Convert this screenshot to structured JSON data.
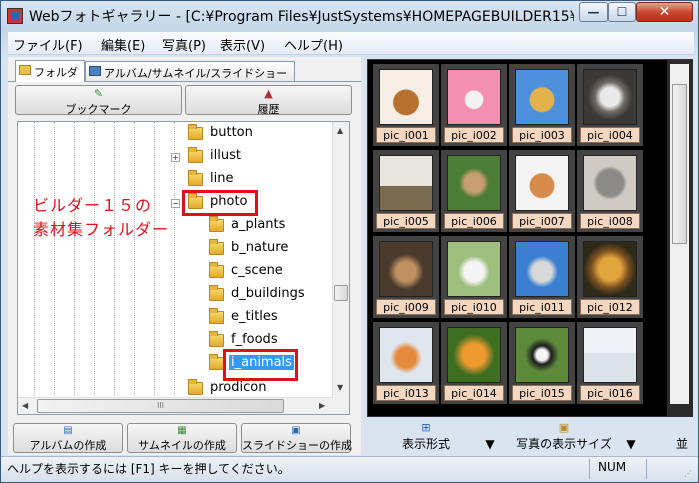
{
  "window": {
    "title": "Webフォトギャラリー - [C:¥Program Files¥JustSystems¥HOMEPAGEBUILDER15¥...",
    "minimize_glyph": "—",
    "maximize_glyph": "☐",
    "close_glyph": "✕",
    "colors": {
      "titlebar": "#c3d6e9",
      "close": "#c7432b",
      "selection": "#3399ff",
      "annotation": "#e0101a",
      "label_bg": "#f3d7c0"
    }
  },
  "menubar": {
    "items": [
      {
        "label": "ファイル(F)"
      },
      {
        "label": "編集(E)"
      },
      {
        "label": "写真(P)"
      },
      {
        "label": "表示(V)"
      },
      {
        "label": "ヘルプ(H)"
      }
    ]
  },
  "left_panel": {
    "tabs": [
      {
        "label": "フォルダ",
        "icon": "folder-icon"
      },
      {
        "label": "アルバム/サムネイル/スライドショー",
        "icon": "album-icon"
      }
    ],
    "bookmark_label": "ブックマーク",
    "history_label": "履歴",
    "tree": {
      "nodes": [
        {
          "label": "button"
        },
        {
          "label": "illust",
          "expander": "+"
        },
        {
          "label": "line"
        },
        {
          "label": "photo",
          "expander": "−"
        },
        {
          "label": "a_plants"
        },
        {
          "label": "b_nature"
        },
        {
          "label": "c_scene"
        },
        {
          "label": "d_buildings"
        },
        {
          "label": "e_titles"
        },
        {
          "label": "f_foods"
        },
        {
          "label": "i_animals",
          "selected": true
        },
        {
          "label": "prodicon"
        }
      ],
      "annotation_line1": "ビルダー１５の",
      "annotation_line2": "素材集フォルダー",
      "hscroll_mark": "III"
    },
    "bottom_buttons": [
      {
        "label": "アルバムの作成"
      },
      {
        "label": "サムネイルの作成"
      },
      {
        "label": "スライドショーの作成"
      }
    ]
  },
  "gallery": {
    "thumbnails": [
      {
        "label": "pic_i001"
      },
      {
        "label": "pic_i002"
      },
      {
        "label": "pic_i003"
      },
      {
        "label": "pic_i004"
      },
      {
        "label": "pic_i005"
      },
      {
        "label": "pic_i006"
      },
      {
        "label": "pic_i007"
      },
      {
        "label": "pic_i008"
      },
      {
        "label": "pic_i009"
      },
      {
        "label": "pic_i010"
      },
      {
        "label": "pic_i011"
      },
      {
        "label": "pic_i012"
      },
      {
        "label": "pic_i013"
      },
      {
        "label": "pic_i014"
      },
      {
        "label": "pic_i015"
      },
      {
        "label": "pic_i016"
      }
    ],
    "toolbar": {
      "view_format_label": "表示形式",
      "photo_size_label": "写真の表示サイズ",
      "sort_label": "並"
    }
  },
  "statusbar": {
    "help_text": "ヘルプを表示するには [F1] キーを押してください。",
    "num_label": "NUM"
  }
}
